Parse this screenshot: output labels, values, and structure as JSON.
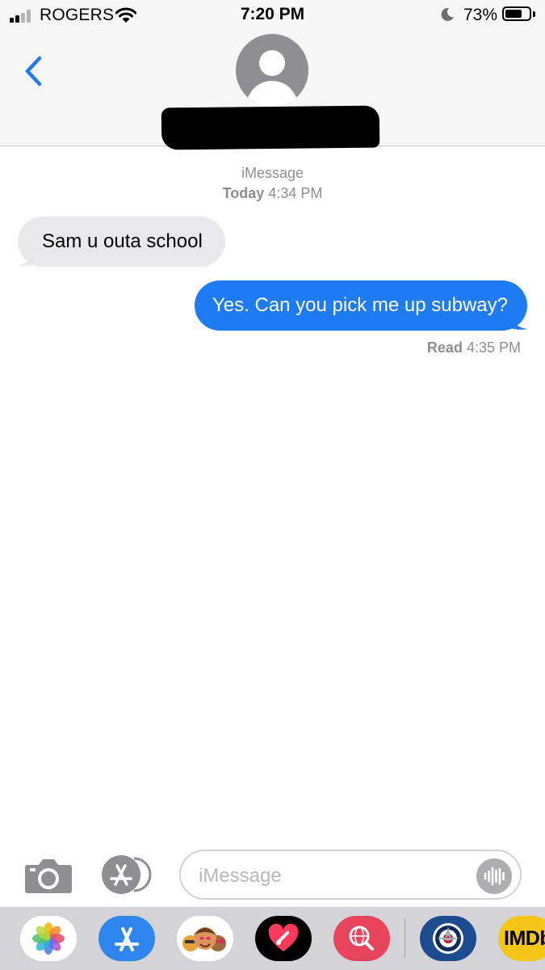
{
  "status_bar": {
    "carrier": "ROGERS",
    "time": "7:20 PM",
    "battery_percent": "73%",
    "battery_level": 0.73,
    "icons": [
      "signal-bars-icon",
      "wifi-icon",
      "moon-icon",
      "battery-icon"
    ]
  },
  "header": {
    "back_icon": "chevron-left-icon",
    "avatar_icon": "contact-silhouette-icon",
    "contact_name": "redacted"
  },
  "conversation": {
    "service": "iMessage",
    "timestamp_day": "Today",
    "timestamp_time": "4:34 PM",
    "messages": [
      {
        "direction": "incoming",
        "text": "Sam u outa school"
      },
      {
        "direction": "outgoing",
        "text": "Yes. Can you pick me up subway?"
      }
    ],
    "read_receipt": {
      "label": "Read",
      "time": "4:35 PM"
    }
  },
  "composer": {
    "placeholder": "iMessage",
    "camera_icon": "camera-icon",
    "apps_icon": "app-store-icon",
    "dictation_icon": "audio-waveform-icon"
  },
  "app_drawer": {
    "apps": [
      {
        "name": "Photos",
        "icon": "photos-icon"
      },
      {
        "name": "App Store",
        "icon": "app-store-icon"
      },
      {
        "name": "Memoji",
        "icon": "memoji-icon"
      },
      {
        "name": "Digital Touch",
        "icon": "digital-touch-icon"
      },
      {
        "name": "Web Search",
        "icon": "web-search-icon"
      },
      {
        "name": "Winnipeg Jets",
        "icon": "jets-logo-icon"
      },
      {
        "name": "IMDb",
        "icon": "imdb-icon",
        "logo_text": "IMDb"
      }
    ]
  },
  "colors": {
    "accent_blue": "#1e7bf3",
    "incoming_bubble": "#e9e9eb",
    "secondary_text": "#8e8e93",
    "header_bg": "#f6f6f6"
  }
}
